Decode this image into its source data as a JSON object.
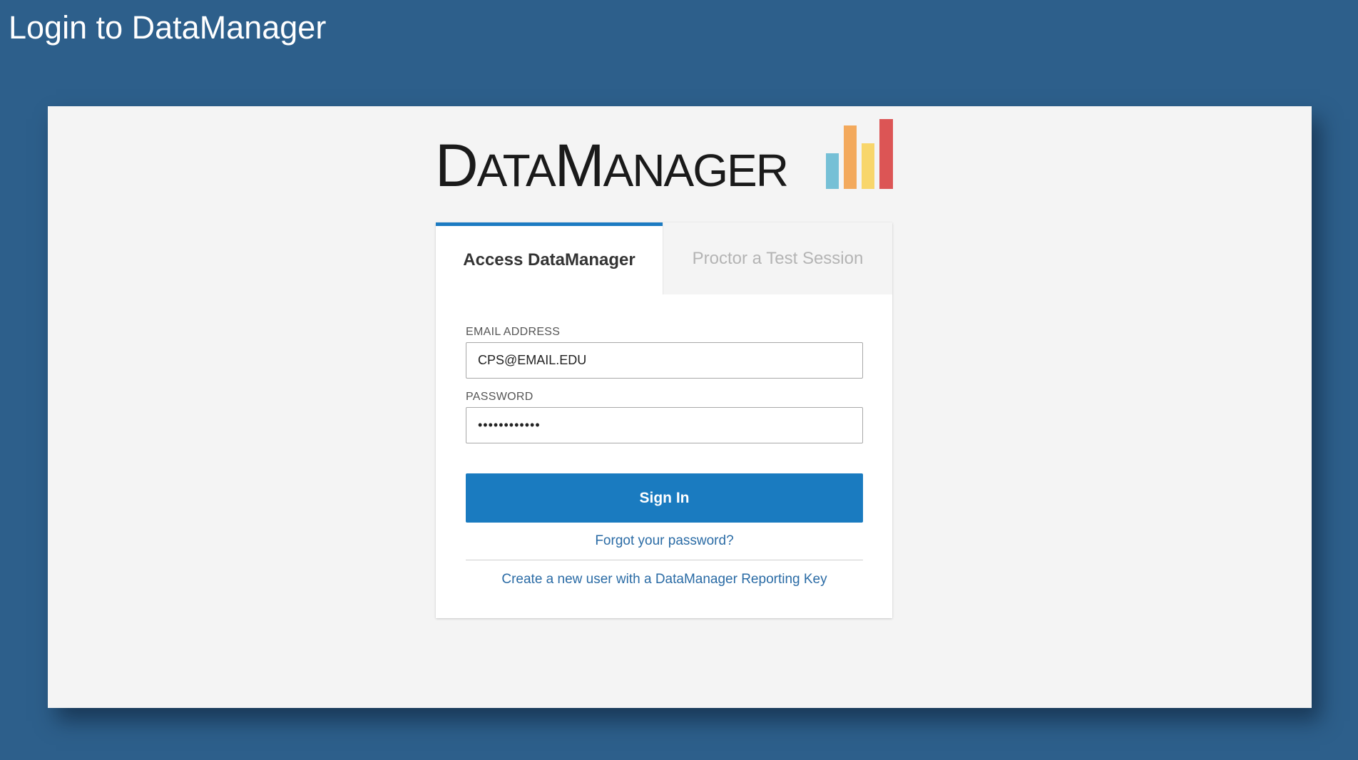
{
  "page": {
    "title": "Login to DataManager"
  },
  "logo": {
    "wordmark_part1": "D",
    "wordmark_part2": "ATA",
    "wordmark_part3": "M",
    "wordmark_part4": "ANAGER",
    "bar_colors": [
      "#76c0d6",
      "#f3a95c",
      "#f8d66b",
      "#dc5555"
    ]
  },
  "tabs": [
    {
      "label": "Access DataManager",
      "active": true
    },
    {
      "label": "Proctor a Test Session",
      "active": false
    }
  ],
  "form": {
    "email_label": "EMAIL ADDRESS",
    "email_value": "CPS@EMAIL.EDU",
    "password_label": "PASSWORD",
    "password_value": "••••••••••••",
    "sign_in_label": "Sign In",
    "forgot_password_label": "Forgot your password?",
    "create_user_label": "Create a new user with a DataManager Reporting Key"
  },
  "colors": {
    "background": "#2d5f8b",
    "accent": "#1a7bc0",
    "link": "#2a6ba5"
  }
}
